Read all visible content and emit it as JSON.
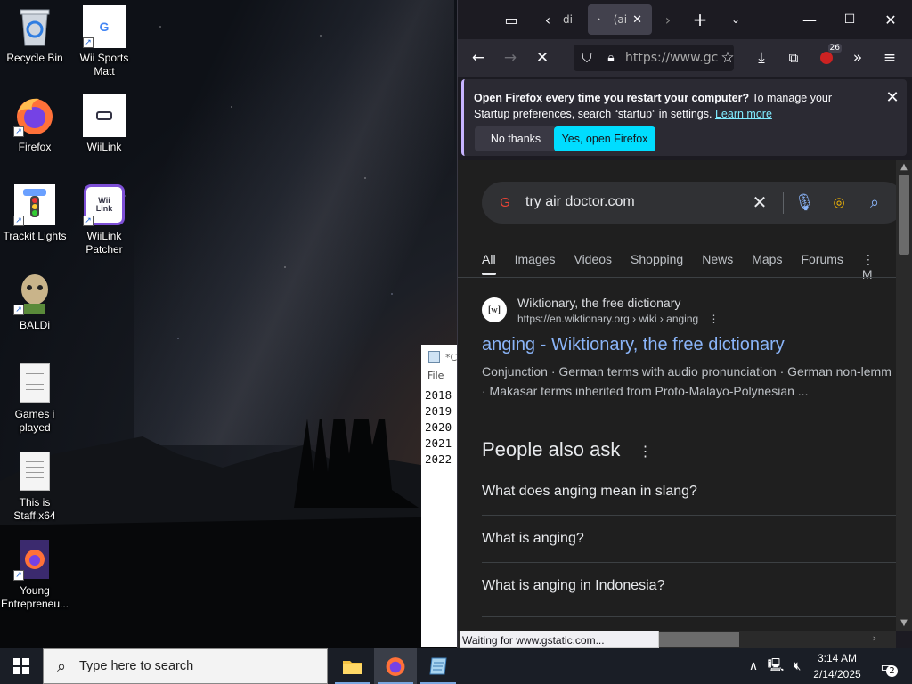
{
  "desktop": {
    "icons": [
      {
        "label": "Recycle Bin"
      },
      {
        "label": "Wii Sports Matt"
      },
      {
        "label": "Firefox"
      },
      {
        "label": "WiiLink"
      },
      {
        "label": "Trackit Lights"
      },
      {
        "label": "WiiLink Patcher"
      },
      {
        "label": "BALDi"
      },
      {
        "label": "Games i played"
      },
      {
        "label": "This is Staff.x64"
      },
      {
        "label": "Young Entrepreneu..."
      }
    ]
  },
  "notepad": {
    "title": "*C",
    "menu": "File",
    "lines": [
      "2018",
      "2019",
      "2020",
      "2021",
      "2022"
    ]
  },
  "firefox": {
    "tabs": [
      {
        "label": "di"
      },
      {
        "label": "(ai"
      }
    ],
    "url": "https://www.gc",
    "container_badge": "26",
    "notification": {
      "bold": "Open Firefox every time you restart your computer?",
      "text": " To manage your Startup preferences, search “startup” in settings. ",
      "link": "Learn more",
      "no_button": "No thanks",
      "yes_button": "Yes, open Firefox"
    },
    "status_text": "Waiting for www.gstatic.com..."
  },
  "google": {
    "query": "try air doctor.com",
    "tabs": [
      "All",
      "Images",
      "Videos",
      "Shopping",
      "News",
      "Maps",
      "Forums",
      "M"
    ],
    "result": {
      "favicon": "[w]",
      "site": "Wiktionary, the free dictionary",
      "crumb": "https://en.wiktionary.org › wiki › anging",
      "title": "anging - Wiktionary, the free dictionary",
      "snippet1": "Conjunction · German terms with audio pronunciation · German non-lemm",
      "snippet2": "· Makasar terms inherited from Proto-Malayo-Polynesian ..."
    },
    "paa": {
      "heading": "People also ask",
      "questions": [
        "What does anging mean in slang?",
        "What is anging?",
        "What is anging in Indonesia?"
      ]
    }
  },
  "taskbar": {
    "search_placeholder": "Type here to search",
    "time": "3:14 AM",
    "date": "2/14/2025",
    "notifications": "2"
  },
  "colors": {
    "accent_cyan": "#00ddff",
    "link_blue": "#8ab4f8",
    "firefox_dark": "#1c1b22"
  }
}
